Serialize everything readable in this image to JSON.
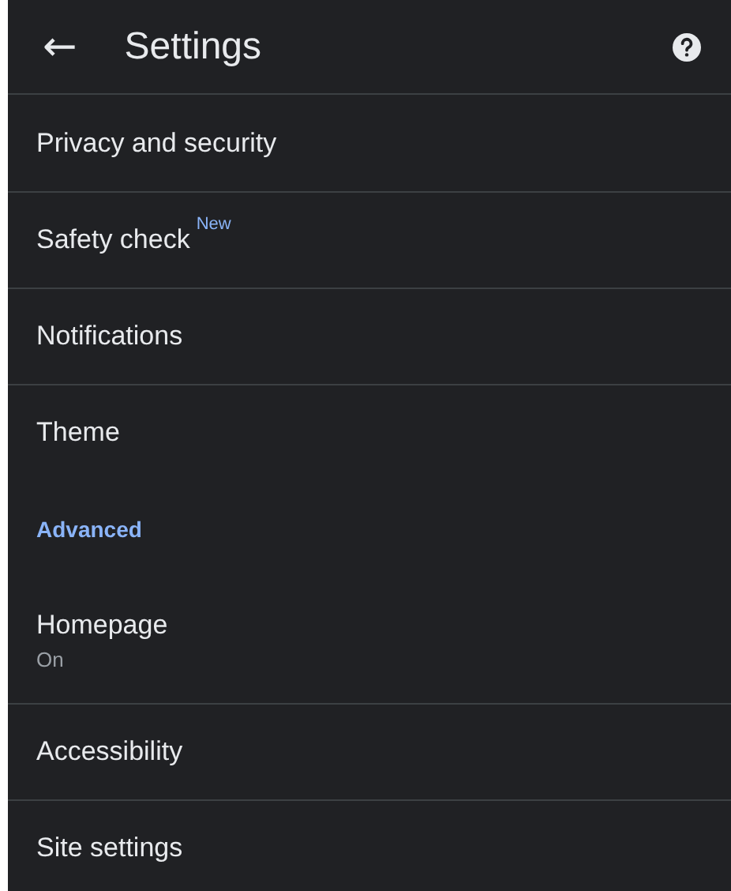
{
  "header": {
    "back": "←",
    "title": "Settings"
  },
  "entries": [
    {
      "kind": "item",
      "label": "Privacy and security"
    },
    {
      "kind": "item",
      "label": "Safety check",
      "badge": "New"
    },
    {
      "kind": "item",
      "label": "Notifications"
    },
    {
      "kind": "item",
      "label": "Theme"
    },
    {
      "kind": "section",
      "label": "Advanced"
    },
    {
      "kind": "item",
      "label": "Homepage",
      "summary": "On"
    },
    {
      "kind": "item",
      "label": "Accessibility"
    },
    {
      "kind": "item",
      "label": "Site settings"
    }
  ]
}
